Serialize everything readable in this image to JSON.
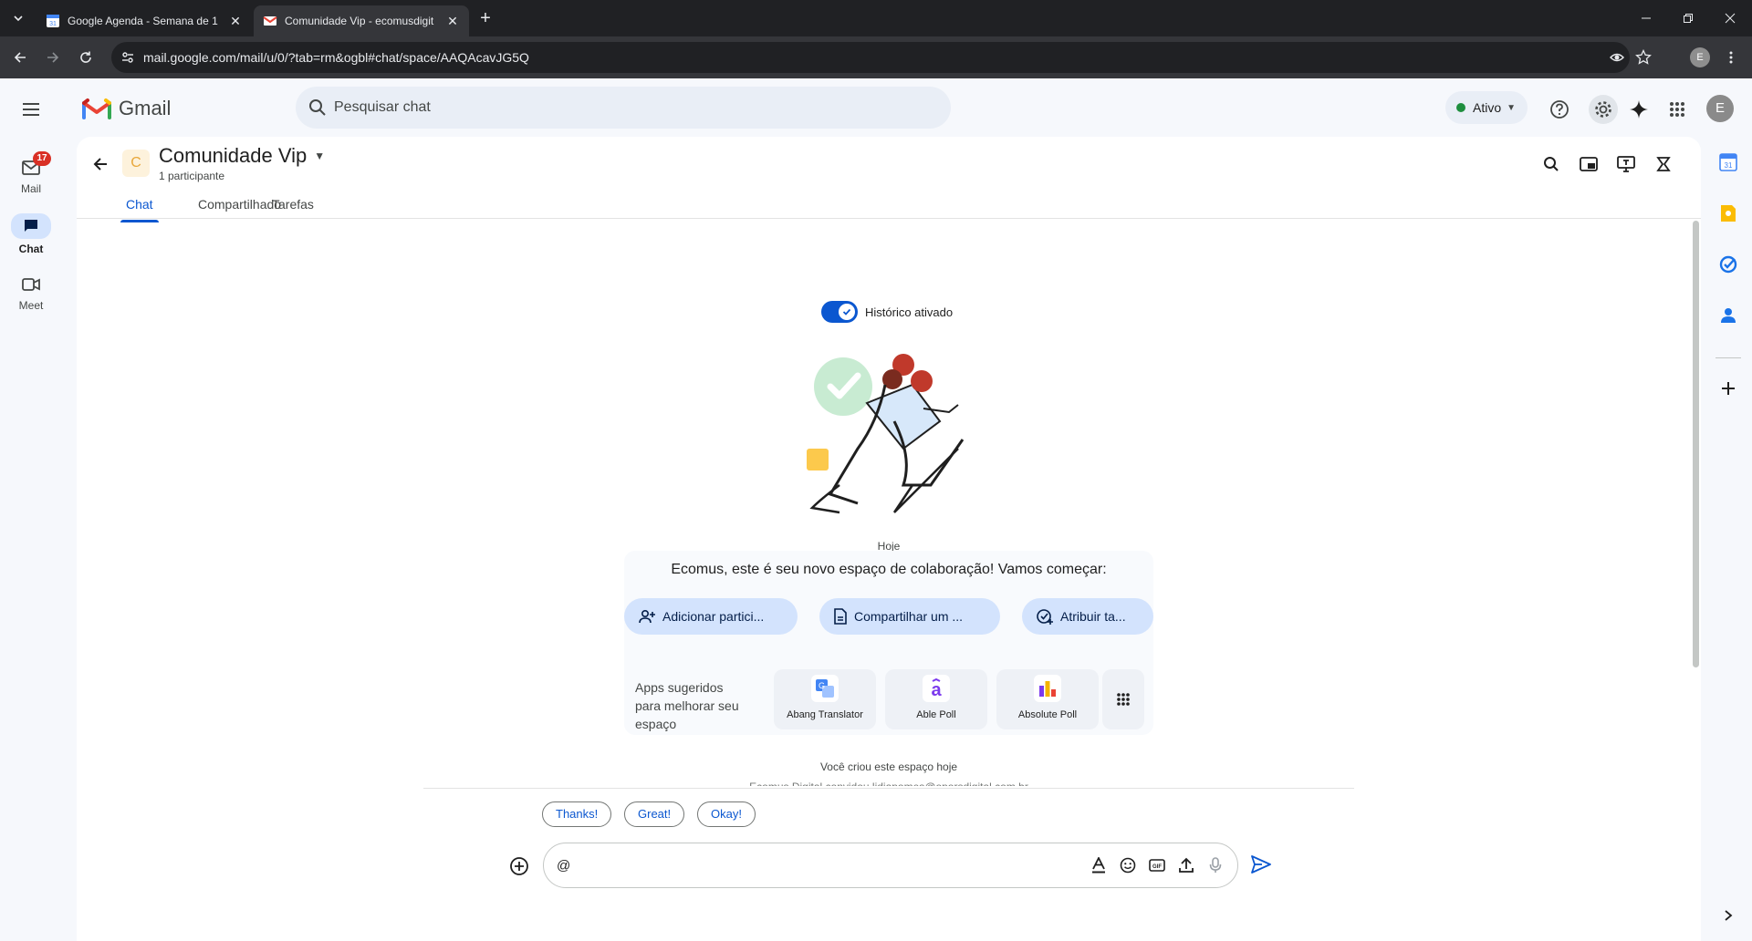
{
  "browser": {
    "tabs": [
      {
        "title": "Google Agenda - Semana de 1",
        "favicon": "calendar-icon",
        "active": false
      },
      {
        "title": "Comunidade Vip - ecomusdigit",
        "favicon": "gmail-icon",
        "active": true
      }
    ],
    "url": "mail.google.com/mail/u/0/?tab=rm&ogbl#chat/space/AAQAcavJG5Q",
    "profile_initial": "E"
  },
  "header": {
    "app_name": "Gmail",
    "search_placeholder": "Pesquisar chat",
    "status_label": "Ativo",
    "status_color": "#1e8e3e",
    "avatar_initial": "E"
  },
  "leftnav": {
    "items": [
      {
        "label": "Mail",
        "icon": "mail-icon"
      },
      {
        "label": "Chat",
        "icon": "chat-icon"
      },
      {
        "label": "Meet",
        "icon": "meet-icon"
      }
    ],
    "mail_badge": "17"
  },
  "space": {
    "avatar_letter": "C",
    "name": "Comunidade Vip",
    "subtitle": "1 participante",
    "tabs": [
      "Chat",
      "Compartilhado",
      "Tarefas"
    ]
  },
  "conversation": {
    "history_label": "Histórico ativado",
    "history_on": true,
    "date_label": "Hoje",
    "welcome": "Ecomus, este é seu novo espaço de colaboração! Vamos começar:",
    "actions": [
      {
        "label": "Adicionar partici...",
        "icon": "person-add-icon"
      },
      {
        "label": "Compartilhar um ...",
        "icon": "file-icon"
      },
      {
        "label": "Atribuir ta...",
        "icon": "task-add-icon"
      }
    ],
    "apps_label": "Apps sugeridos para melhorar seu espaço",
    "apps": [
      {
        "name": "Abang Translator",
        "icon": "translator-icon"
      },
      {
        "name": "Able Poll",
        "icon": "able-poll-icon"
      },
      {
        "name": "Absolute Poll",
        "icon": "absolute-poll-icon"
      }
    ],
    "created_label": "Você criou este espaço hoje",
    "created_partial": "Ecomus Digital convidou lidiapomes@oporsdigital.com.br"
  },
  "quick_replies": [
    "Thanks!",
    "Great!",
    "Okay!"
  ],
  "composer": {
    "value": "@"
  }
}
